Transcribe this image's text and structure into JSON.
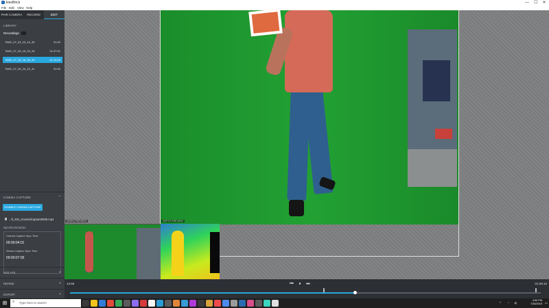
{
  "window": {
    "title": "kinoBrick",
    "minimize": "—",
    "maximize": "☐",
    "close": "✕"
  },
  "menu": [
    "File",
    "Edit",
    "View",
    "Help"
  ],
  "tabs": [
    {
      "label": "PAIR CAMERA",
      "active": false
    },
    {
      "label": "RECORD",
      "active": false
    },
    {
      "label": "EDIT",
      "active": true
    }
  ],
  "library": {
    "section_label": "LIBRARY",
    "recordings_label": "Recordings",
    "takes": [
      {
        "name": "TAKE_07_23_23_44_30",
        "duration": "01:00",
        "selected": false
      },
      {
        "name": "TAKE_07_25_15_03_25",
        "duration": "01:37:01",
        "selected": false
      },
      {
        "name": "TAKE_07_26_18_06_20",
        "duration": "01:10:10",
        "selected": true
      },
      {
        "name": "TAKE_07_26_24_22_41",
        "duration": "01:00",
        "selected": false
      }
    ]
  },
  "cinema": {
    "section_label": "CINEMA CAPTURE",
    "collapse_icon": "−",
    "disable_button": "DISABLE CINEMA CAPTURE",
    "file_name": "...ft_SSI_cinema\\Capture0006.mp4",
    "sync_label": "Synchronization",
    "cinema_sync_label": "Cinema Capture Sync Time",
    "cinema_sync_time": "00:00:04:01",
    "sensor_sync_label": "Sensor Capture Sync Time",
    "sensor_sync_time": "00:00:07:05"
  },
  "panels": [
    {
      "label": "ISOLATE",
      "icon": "+"
    },
    {
      "label": "REFINE",
      "icon": "+"
    },
    {
      "label": "EXPORT",
      "icon": "+"
    }
  ],
  "previews": {
    "video_label": "VIDEO PREVIEW",
    "depth_label": "DEPTH PREVIEW"
  },
  "transport": {
    "current_time": "43:65",
    "end_time": "01:08:10",
    "prev_icon": "⏮",
    "pause_icon": "⏸",
    "next_icon": "⏭",
    "progress": 0.605,
    "in_marker": 0.54,
    "out_marker": 0.99
  },
  "taskbar": {
    "start_icon": "⊞",
    "search_icon": "⌕",
    "search_placeholder": "Type here to search",
    "time": "4:50 PM",
    "date": "7/26/2019",
    "icon_colors": [
      "#3a3a3a",
      "#f0c419",
      "#2f7bd6",
      "#e04b3a",
      "#3aa757",
      "#5b5b5b",
      "#8a6df0",
      "#d63a3a",
      "#f4f4f4",
      "#2b9bd6",
      "#5b5b5b",
      "#e0863a",
      "#3a9ad6",
      "#b03ad6",
      "#3a3a3a",
      "#d6a23a",
      "#f04b4b",
      "#4b8af0",
      "#9a9a9a",
      "#2b6cb0",
      "#d94f8a",
      "#5b5b5b",
      "#3ad6c0",
      "#e0e0e0"
    ]
  },
  "colors": {
    "accent": "#29a8e0",
    "sidebar": "#3b3e43",
    "greenscreen": "#22a133"
  }
}
